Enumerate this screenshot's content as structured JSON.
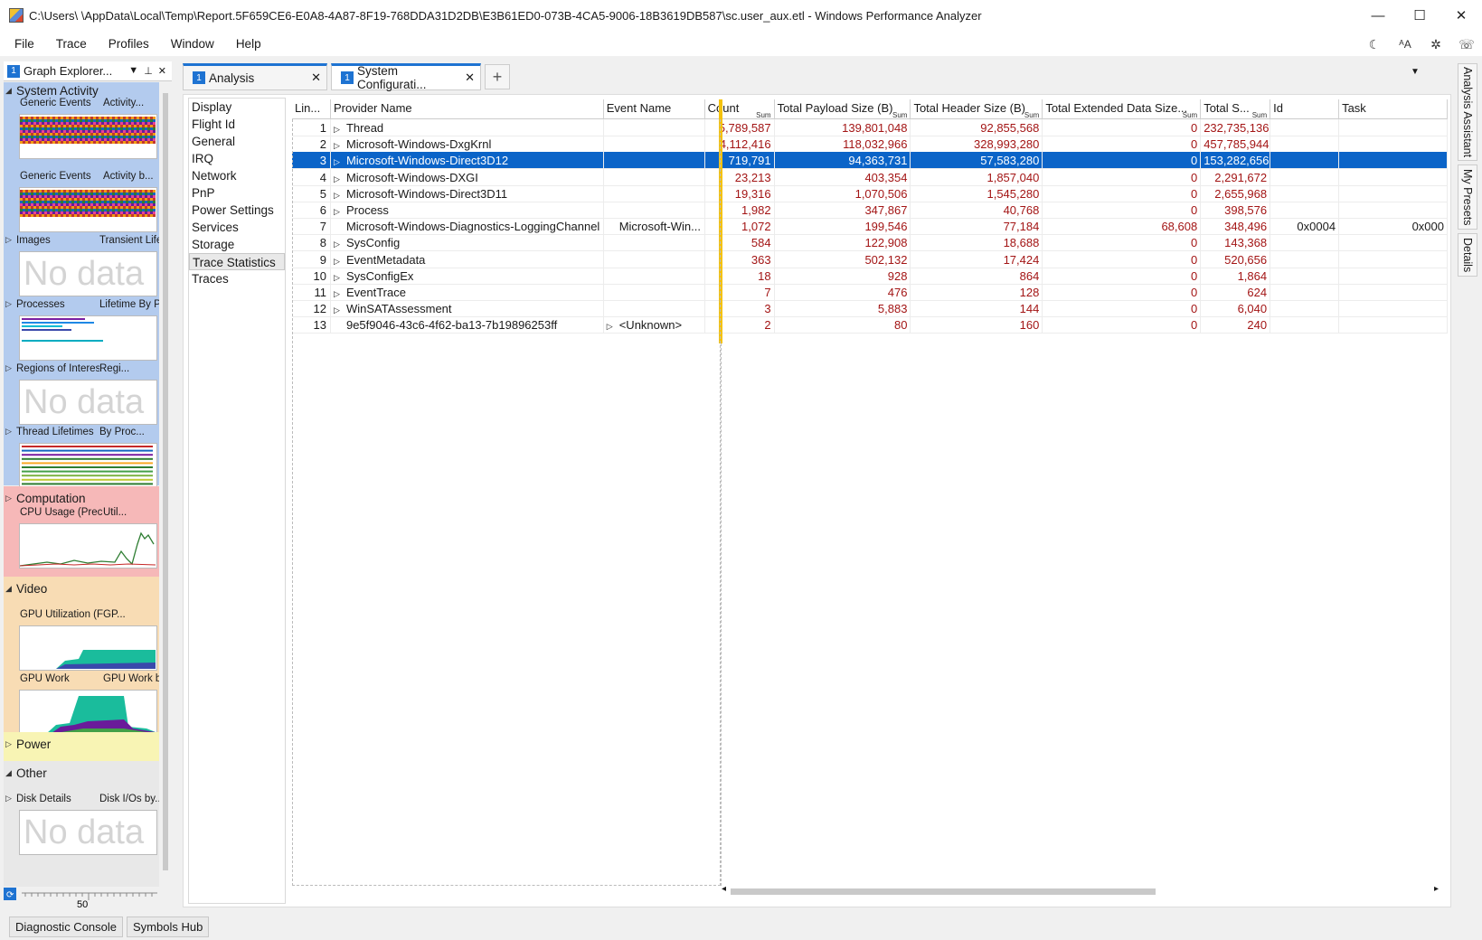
{
  "window": {
    "title": "C:\\Users\\        \\AppData\\Local\\Temp\\Report.5F659CE6-E0A8-4A87-8F19-768DDA31D2DB\\E3B61ED0-073B-4CA5-9006-18B3619DB587\\sc.user_aux.etl - Windows Performance Analyzer",
    "minimize": "—",
    "maximize": "☐",
    "close": "✕"
  },
  "menu": {
    "items": [
      "File",
      "Trace",
      "Profiles",
      "Window",
      "Help"
    ],
    "icons": [
      "moon-icon",
      "text-size-icon",
      "bug-icon",
      "feedback-icon"
    ]
  },
  "graph_explorer": {
    "badge": "1",
    "title": "Graph Explorer...",
    "sections": [
      {
        "name": "System Activity",
        "expanded": true,
        "color": "#b3cbee",
        "items": [
          {
            "label1": "Generic Events",
            "label2": "Activity...",
            "nodata": false
          },
          {
            "label1": "Generic Events",
            "label2": "Activity b...",
            "nodata": false
          },
          {
            "label1": "Images",
            "label2": "Transient Lifetim...",
            "nodata": true
          },
          {
            "label1": "Processes",
            "label2": "Lifetime By Pro...",
            "nodata": false
          },
          {
            "label1": "Regions of Interest",
            "label2": "Regi...",
            "nodata": true
          },
          {
            "label1": "Thread Lifetimes",
            "label2": "By Proc...",
            "nodata": false
          }
        ]
      },
      {
        "name": "Computation",
        "expanded": false,
        "color": "#f6b8b8",
        "items": [
          {
            "label1": "CPU Usage (Precise)",
            "label2": "Util...",
            "nodata": false
          }
        ]
      },
      {
        "name": "Video",
        "expanded": true,
        "color": "#f8dcb4",
        "items": [
          {
            "label1": "GPU Utilization (FM)",
            "label2": "GP...",
            "nodata": false
          },
          {
            "label1": "GPU Work",
            "label2": "GPU Work by...",
            "nodata": false
          }
        ]
      },
      {
        "name": "Power",
        "expanded": false,
        "color": "#f8f4b4",
        "items": []
      },
      {
        "name": "Other",
        "expanded": true,
        "color": "#e8e8e8",
        "items": [
          {
            "label1": "Disk Details",
            "label2": "Disk I/Os by...",
            "nodata": true
          }
        ]
      }
    ],
    "nodata_text": "No data",
    "timeline_tick": "50"
  },
  "tabs": [
    {
      "badge": "1",
      "label": "Analysis"
    },
    {
      "badge": "1",
      "label": "System Configurati..."
    }
  ],
  "categories": [
    "Display",
    "Flight Id",
    "General",
    "IRQ",
    "Network",
    "PnP",
    "Power Settings",
    "Services",
    "Storage",
    "Trace Statistics",
    "Traces"
  ],
  "selected_category": "Trace Statistics",
  "table": {
    "columns": [
      "Lin...",
      "Provider Name",
      "Event Name",
      "Count",
      "Total Payload Size (B)",
      "Total Header Size (B)",
      "Total Extended Data Size...",
      "Total S...",
      "Id",
      "Task"
    ],
    "sum_label": "Sum",
    "rows": [
      {
        "line": "1",
        "provider": "Thread",
        "event": "",
        "count": "5,789,587",
        "payload": "139,801,048",
        "header": "92,855,568",
        "ext": "0",
        "total": "232,735,136",
        "id": "",
        "task": "",
        "expand": true
      },
      {
        "line": "2",
        "provider": "Microsoft-Windows-DxgKrnl",
        "event": "",
        "count": "4,112,416",
        "payload": "118,032,966",
        "header": "328,993,280",
        "ext": "0",
        "total": "457,785,944",
        "id": "",
        "task": "",
        "expand": true
      },
      {
        "line": "3",
        "provider": "Microsoft-Windows-Direct3D12",
        "event": "",
        "count": "719,791",
        "payload": "94,363,731",
        "header": "57,583,280",
        "ext": "0",
        "total": "153,282,656",
        "id": "",
        "task": "",
        "expand": true,
        "selected": true
      },
      {
        "line": "4",
        "provider": "Microsoft-Windows-DXGI",
        "event": "",
        "count": "23,213",
        "payload": "403,354",
        "header": "1,857,040",
        "ext": "0",
        "total": "2,291,672",
        "id": "",
        "task": "",
        "expand": true
      },
      {
        "line": "5",
        "provider": "Microsoft-Windows-Direct3D11",
        "event": "",
        "count": "19,316",
        "payload": "1,070,506",
        "header": "1,545,280",
        "ext": "0",
        "total": "2,655,968",
        "id": "",
        "task": "",
        "expand": true
      },
      {
        "line": "6",
        "provider": "Process",
        "event": "",
        "count": "1,982",
        "payload": "347,867",
        "header": "40,768",
        "ext": "0",
        "total": "398,576",
        "id": "",
        "task": "",
        "expand": true
      },
      {
        "line": "7",
        "provider": "Microsoft-Windows-Diagnostics-LoggingChannel",
        "event": "Microsoft-Win...",
        "count": "1,072",
        "payload": "199,546",
        "header": "77,184",
        "ext": "68,608",
        "total": "348,496",
        "id": "0x0004",
        "task": "0x000",
        "expand": false
      },
      {
        "line": "8",
        "provider": "SysConfig",
        "event": "",
        "count": "584",
        "payload": "122,908",
        "header": "18,688",
        "ext": "0",
        "total": "143,368",
        "id": "",
        "task": "",
        "expand": true
      },
      {
        "line": "9",
        "provider": "EventMetadata",
        "event": "",
        "count": "363",
        "payload": "502,132",
        "header": "17,424",
        "ext": "0",
        "total": "520,656",
        "id": "",
        "task": "",
        "expand": true
      },
      {
        "line": "10",
        "provider": "SysConfigEx",
        "event": "",
        "count": "18",
        "payload": "928",
        "header": "864",
        "ext": "0",
        "total": "1,864",
        "id": "",
        "task": "",
        "expand": true
      },
      {
        "line": "11",
        "provider": "EventTrace",
        "event": "",
        "count": "7",
        "payload": "476",
        "header": "128",
        "ext": "0",
        "total": "624",
        "id": "",
        "task": "",
        "expand": true
      },
      {
        "line": "12",
        "provider": "WinSATAssessment",
        "event": "",
        "count": "3",
        "payload": "5,883",
        "header": "144",
        "ext": "0",
        "total": "6,040",
        "id": "",
        "task": "",
        "expand": true
      },
      {
        "line": "13",
        "provider": "9e5f9046-43c6-4f62-ba13-7b19896253ff",
        "event": "<Unknown>",
        "count": "2",
        "payload": "80",
        "header": "160",
        "ext": "0",
        "total": "240",
        "id": "",
        "task": "",
        "expand": false,
        "event_expand": true
      }
    ]
  },
  "right_tabs": [
    "Analysis Assistant",
    "My Presets",
    "Details"
  ],
  "bottom": {
    "diagnostic": "Diagnostic Console",
    "symbols": "Symbols Hub"
  }
}
